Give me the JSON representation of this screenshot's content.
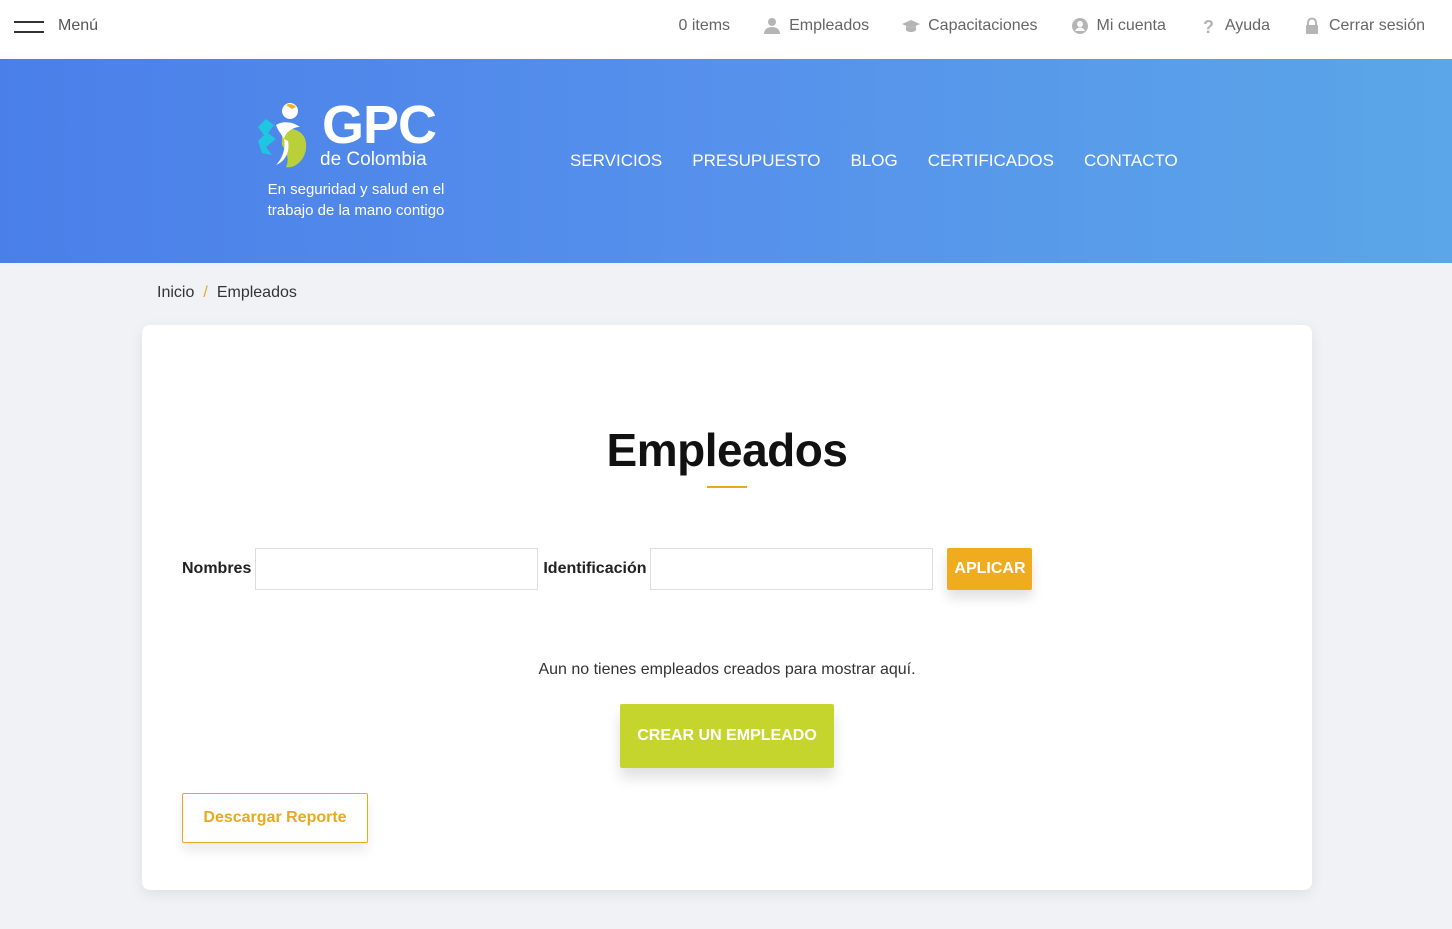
{
  "topbar": {
    "menu_label": "Menú",
    "links": [
      {
        "label": "0 items",
        "icon": "cart-icon"
      },
      {
        "label": "Empleados",
        "icon": "user-icon"
      },
      {
        "label": "Capacitaciones",
        "icon": "graduation-cap-icon"
      },
      {
        "label": "Mi cuenta",
        "icon": "account-circle-icon"
      },
      {
        "label": "Ayuda",
        "icon": "question-icon"
      },
      {
        "label": "Cerrar sesión",
        "icon": "lock-icon"
      }
    ]
  },
  "brand": {
    "logo_main": "GPC",
    "logo_sub": "de Colombia",
    "tagline": "En seguridad y salud en el trabajo de la mano contigo"
  },
  "main_nav": [
    "SERVICIOS",
    "PRESUPUESTO",
    "BLOG",
    "CERTIFICADOS",
    "CONTACTO"
  ],
  "breadcrumb": {
    "home": "Inicio",
    "separator": "/",
    "current": "Empleados"
  },
  "content": {
    "title": "Empleados",
    "filters": {
      "names_label": "Nombres",
      "names_value": "",
      "id_label": "Identificación",
      "id_value": "",
      "apply_label": "APLICAR"
    },
    "empty_message": "Aun no tienes empleados creados para mostrar aquí.",
    "create_label": "CREAR UN EMPLEADO",
    "report_label": "Descargar Reporte"
  },
  "colors": {
    "accent_orange": "#efac1f",
    "accent_green": "#c6d52e",
    "hero_blue": "#4a7fe9"
  }
}
